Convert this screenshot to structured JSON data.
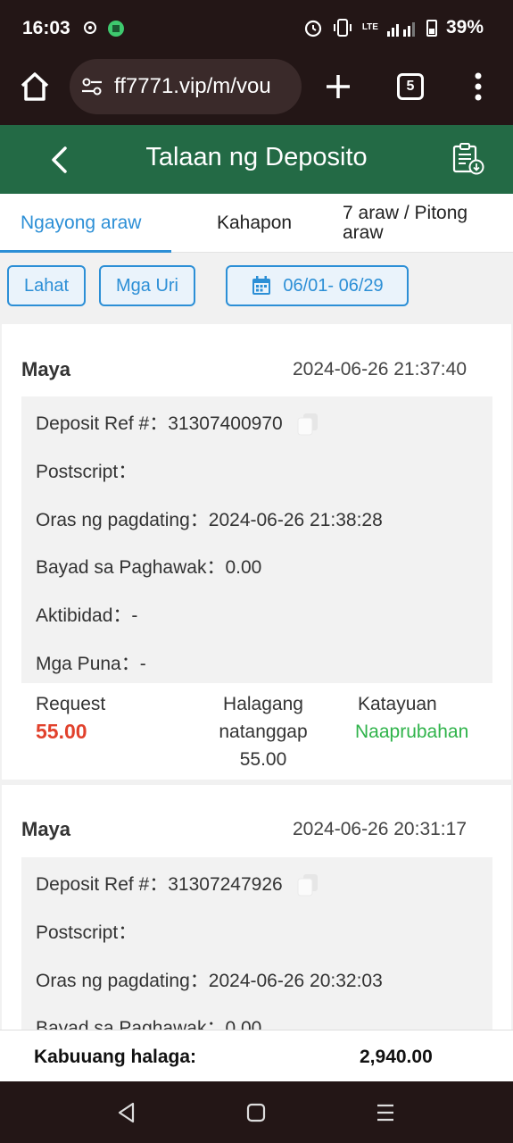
{
  "status_bar": {
    "time": "16:03",
    "battery": "39%",
    "network": "LTE",
    "icons": [
      "notification-icon",
      "app-icon",
      "alarm-icon",
      "vibrate-icon",
      "signal-icon",
      "battery-icon"
    ]
  },
  "browser": {
    "url": "ff7771.vip/m/vou",
    "tab_count": "5"
  },
  "header": {
    "title": "Talaan ng Deposito"
  },
  "tabs": [
    {
      "label": "Ngayong araw",
      "active": true
    },
    {
      "label": "Kahapon",
      "active": false
    },
    {
      "label": "7 araw / Pitong araw",
      "active": false
    }
  ],
  "filters": {
    "all": "Lahat",
    "types": "Mga Uri",
    "date_range": "06/01- 06/29"
  },
  "records": [
    {
      "method": "Maya",
      "datetime": "2024-06-26 21:37:40",
      "ref_label": "Deposit Ref #：",
      "ref": "31307400970",
      "postscript_label": "Postscript：",
      "postscript": "",
      "arrival_label": "Oras ng pagdating：",
      "arrival": "2024-06-26 21:38:28",
      "fee_label": "Bayad sa Paghawak：",
      "fee": "0.00",
      "activity_label": "Aktibidad：",
      "activity": "-",
      "remarks_label": "Mga Puna：",
      "remarks": "-",
      "request_label": "Request",
      "request_amount": "55.00",
      "received_label_1": "Halagang",
      "received_label_2": "natanggap",
      "received_amount": "55.00",
      "status_label": "Katayuan",
      "status": "Naaprubahan"
    },
    {
      "method": "Maya",
      "datetime": "2024-06-26 20:31:17",
      "ref_label": "Deposit Ref #：",
      "ref": "31307247926",
      "postscript_label": "Postscript：",
      "postscript": "",
      "arrival_label": "Oras ng pagdating：",
      "arrival": "2024-06-26 20:32:03",
      "fee_label": "Bayad sa Paghawak：",
      "fee": "0.00"
    }
  ],
  "total": {
    "label": "Kabuuang halaga:",
    "value": "2,940.00"
  },
  "colors": {
    "header_green": "#236a45",
    "accent_blue": "#2c8fd6",
    "request_red": "#e1412c",
    "status_green": "#2fb34a"
  }
}
